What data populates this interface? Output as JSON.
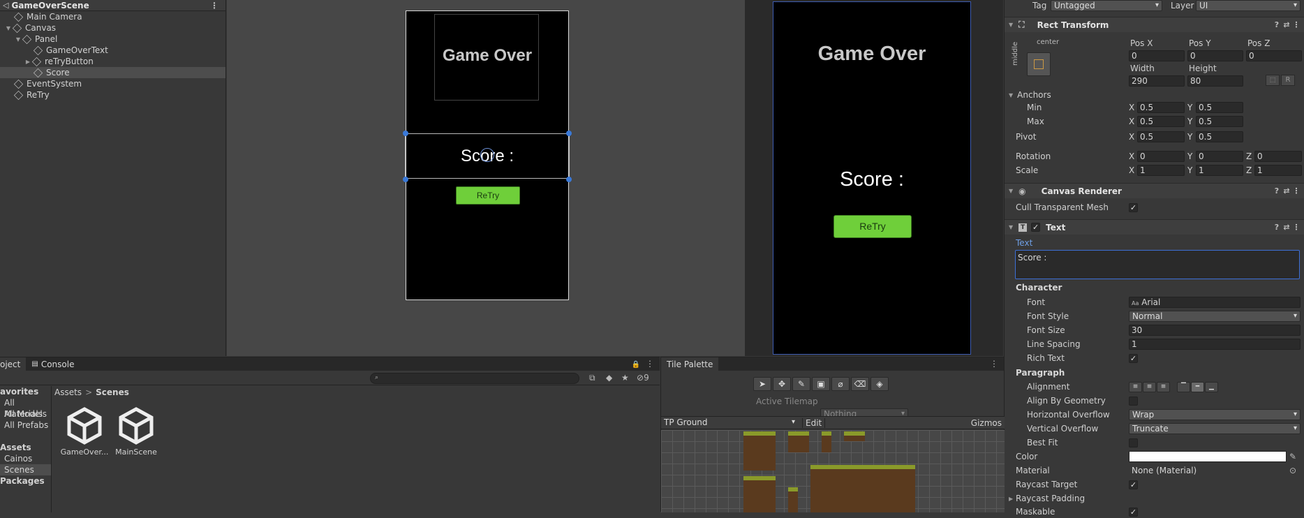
{
  "hierarchy": {
    "scene_name": "GameOverScene",
    "items": [
      {
        "label": "Main Camera"
      },
      {
        "label": "Canvas"
      },
      {
        "label": "Panel"
      },
      {
        "label": "GameOverText"
      },
      {
        "label": "reTryButton"
      },
      {
        "label": "Score"
      },
      {
        "label": "EventSystem"
      },
      {
        "label": "ReTry"
      }
    ]
  },
  "scene": {
    "game_over_text": "Game Over",
    "score_text": "Score :",
    "retry_text": "ReTry"
  },
  "game": {
    "game_over_text": "Game Over",
    "score_text": "Score :",
    "retry_text": "ReTry"
  },
  "inspector": {
    "tag_label": "Tag",
    "tag_value": "Untagged",
    "layer_label": "Layer",
    "layer_value": "UI",
    "rect_transform": {
      "title": "Rect Transform",
      "anchor_h": "center",
      "anchor_v": "middle",
      "pos_x_label": "Pos X",
      "pos_x": "0",
      "pos_y_label": "Pos Y",
      "pos_y": "0",
      "pos_z_label": "Pos Z",
      "pos_z": "0",
      "width_label": "Width",
      "width": "290",
      "height_label": "Height",
      "height": "80",
      "r_button": "R",
      "anchors_label": "Anchors",
      "min_label": "Min",
      "min_x": "0.5",
      "min_y": "0.5",
      "max_label": "Max",
      "max_x": "0.5",
      "max_y": "0.5",
      "pivot_label": "Pivot",
      "pivot_x": "0.5",
      "pivot_y": "0.5",
      "rotation_label": "Rotation",
      "rot_x": "0",
      "rot_y": "0",
      "rot_z": "0",
      "scale_label": "Scale",
      "scale_x": "1",
      "scale_y": "1",
      "scale_z": "1",
      "x": "X",
      "y": "Y",
      "z": "Z"
    },
    "canvas_renderer": {
      "title": "Canvas Renderer",
      "cull_label": "Cull Transparent Mesh"
    },
    "text_comp": {
      "title": "Text",
      "text_label": "Text",
      "text_value": "Score :",
      "character_label": "Character",
      "font_label": "Font",
      "font_value": "Arial",
      "font_prefix": "Aa",
      "font_style_label": "Font Style",
      "font_style_value": "Normal",
      "font_size_label": "Font Size",
      "font_size_value": "30",
      "line_spacing_label": "Line Spacing",
      "line_spacing_value": "1",
      "rich_text_label": "Rich Text",
      "paragraph_label": "Paragraph",
      "alignment_label": "Alignment",
      "align_geom_label": "Align By Geometry",
      "h_overflow_label": "Horizontal Overflow",
      "h_overflow_value": "Wrap",
      "v_overflow_label": "Vertical Overflow",
      "v_overflow_value": "Truncate",
      "best_fit_label": "Best Fit",
      "color_label": "Color",
      "material_label": "Material",
      "material_value": "None (Material)",
      "raycast_target_label": "Raycast Target",
      "raycast_padding_label": "Raycast Padding",
      "maskable_label": "Maskable"
    }
  },
  "project": {
    "tab_project": "oject",
    "tab_console": "Console",
    "favorites_label": "avorites",
    "favorites": [
      "All Materials",
      "All Models",
      "All Prefabs"
    ],
    "assets_label": "Assets",
    "assets": [
      "Cainos",
      "Scenes"
    ],
    "packages_label": "Packages",
    "breadcrumb_root": "Assets",
    "breadcrumb_sep": ">",
    "breadcrumb_current": "Scenes",
    "hidden_count": "9",
    "files": [
      {
        "label": "GameOver..."
      },
      {
        "label": "MainScene"
      }
    ]
  },
  "tile_palette": {
    "tab": "Tile Palette",
    "active_tilemap_label": "Active Tilemap",
    "active_tilemap_value": "Nothing",
    "palette_name": "TP Ground",
    "edit_label": "Edit",
    "gizmos_label": "Gizmos"
  },
  "colors": {
    "selection_blue": "#3a79d8",
    "retry_green": "#6fcf3a",
    "text_field_border": "#3d6fd6"
  }
}
